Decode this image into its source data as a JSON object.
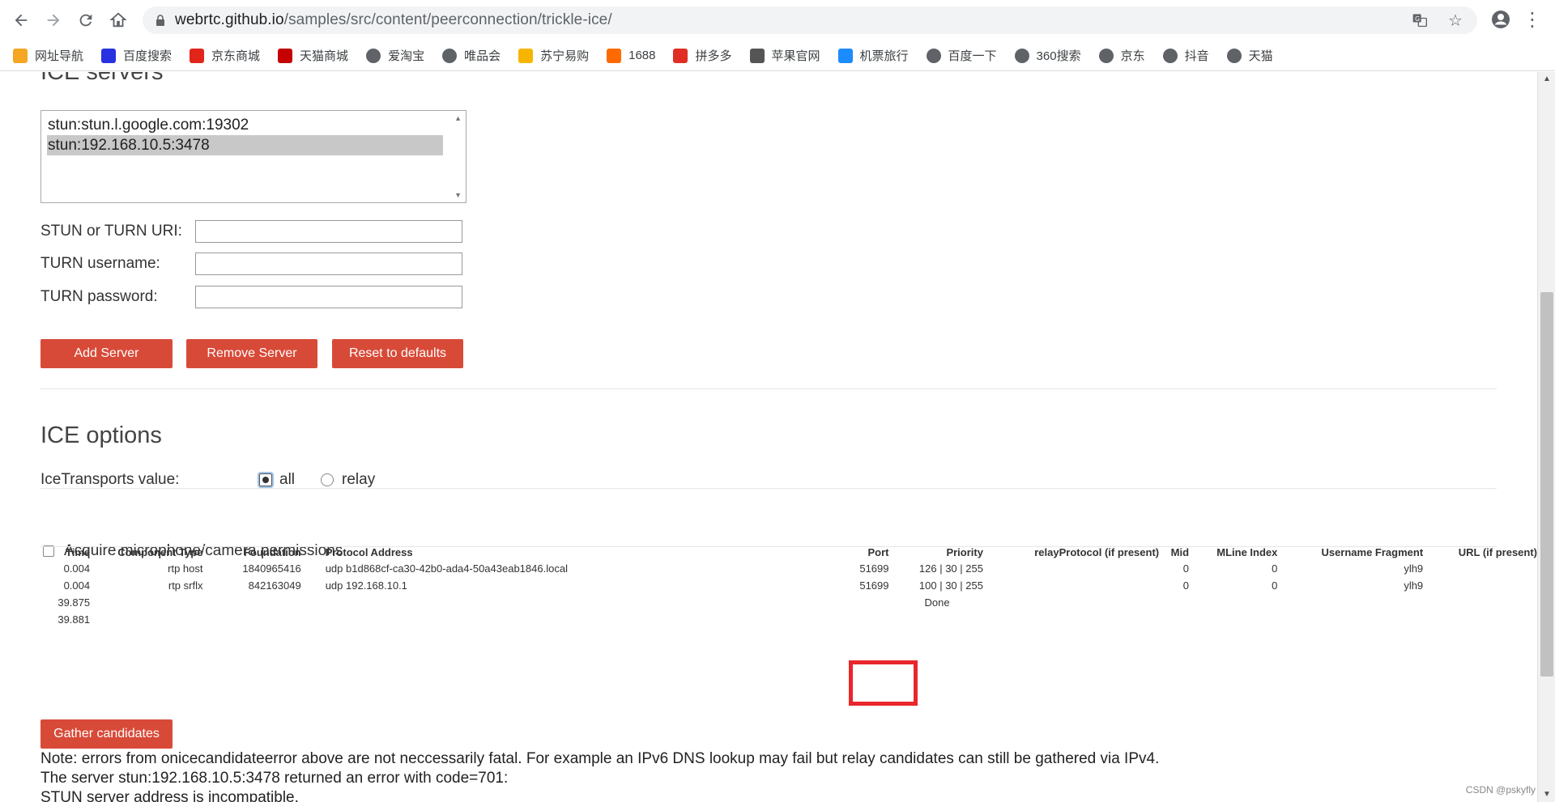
{
  "browser": {
    "url_host": "webrtc.github.io",
    "url_path": "/samples/src/content/peerconnection/trickle-ice/"
  },
  "bookmarks": [
    {
      "label": "网址导航",
      "color": "#f5a623"
    },
    {
      "label": "百度搜索",
      "color": "#2932e1"
    },
    {
      "label": "京东商城",
      "color": "#e1251b"
    },
    {
      "label": "天猫商城",
      "color": "#c40000"
    },
    {
      "label": "爱淘宝",
      "color": "#5f6368"
    },
    {
      "label": "唯品会",
      "color": "#5f6368"
    },
    {
      "label": "苏宁易购",
      "color": "#f7b500"
    },
    {
      "label": "1688",
      "color": "#ff6a00"
    },
    {
      "label": "拼多多",
      "color": "#e02e24"
    },
    {
      "label": "苹果官网",
      "color": "#555555"
    },
    {
      "label": "机票旅行",
      "color": "#1a8cff"
    },
    {
      "label": "百度一下",
      "color": "#5f6368"
    },
    {
      "label": "360搜索",
      "color": "#5f6368"
    },
    {
      "label": "京东",
      "color": "#5f6368"
    },
    {
      "label": "抖音",
      "color": "#5f6368"
    },
    {
      "label": "天猫",
      "color": "#5f6368"
    }
  ],
  "ice_servers": {
    "title": "ICE servers",
    "items": [
      "stun:stun.l.google.com:19302",
      "stun:192.168.10.5:3478"
    ],
    "selected_index": 1,
    "fields": [
      {
        "label": "STUN or TURN URI:",
        "value": ""
      },
      {
        "label": "TURN username:",
        "value": ""
      },
      {
        "label": "TURN password:",
        "value": ""
      }
    ],
    "buttons": {
      "add": "Add Server",
      "remove": "Remove Server",
      "reset": "Reset to defaults"
    }
  },
  "ice_options": {
    "title": "ICE options",
    "transports_label": "IceTransports value:",
    "options": [
      "all",
      "relay"
    ],
    "selected": "all",
    "acquire_label": "Acquire microphone/camera permissions",
    "acquire_checked": false
  },
  "candidates": {
    "headers": [
      "Time",
      "Component Type",
      "Foundation",
      "Protocol Address",
      "Port",
      "Priority",
      "relayProtocol (if present)",
      "Mid",
      "MLine Index",
      "Username Fragment",
      "URL (if present)"
    ],
    "rows": [
      [
        "0.004",
        "rtp host",
        "1840965416",
        "udp b1d868cf-ca30-42b0-ada4-50a43eab1846.local",
        "51699",
        "126 | 30 | 255",
        "",
        "0",
        "0",
        "ylh9",
        ""
      ],
      [
        "0.004",
        "rtp srflx",
        "842163049",
        "udp 192.168.10.1",
        "51699",
        "100 | 30 | 255",
        "",
        "0",
        "0",
        "ylh9",
        ""
      ],
      [
        "39.875",
        "",
        "",
        "",
        "",
        "Done",
        "",
        "",
        "",
        "",
        ""
      ],
      [
        "39.881",
        "",
        "",
        "",
        "",
        "",
        "",
        "",
        "",
        "",
        ""
      ]
    ],
    "gather_button": "Gather candidates"
  },
  "notes": {
    "line1": "Note: errors from onicecandidateerror above are not neccessarily fatal. For example an IPv6 DNS lookup may fail but relay candidates can still be gathered via IPv4.",
    "line2": "The server stun:192.168.10.5:3478 returned an error with code=701:",
    "line3": "STUN server address is incompatible."
  },
  "watermark": "CSDN @pskyfly",
  "accent_color": "#d84a38",
  "highlight_color": "#e8262b"
}
